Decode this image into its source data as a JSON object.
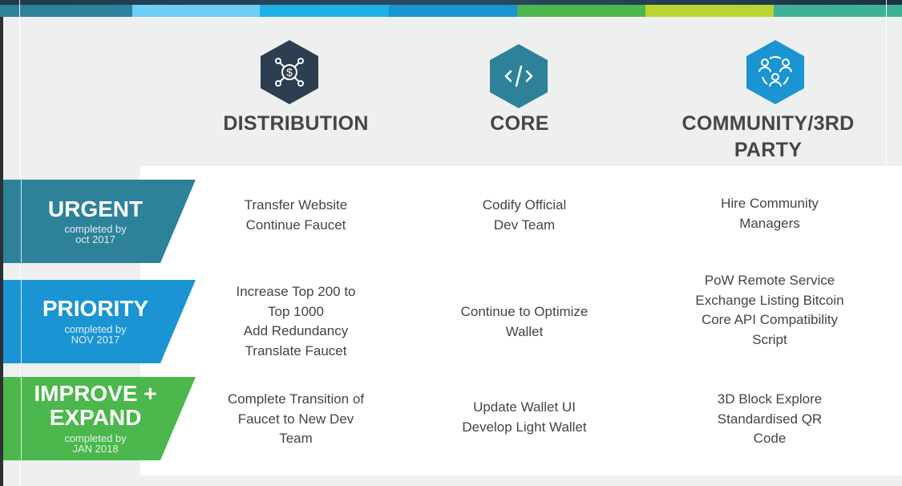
{
  "stripes": [
    {
      "color": "#2d8299"
    },
    {
      "color": "#6fcef5"
    },
    {
      "color": "#1fb0e6"
    },
    {
      "color": "#1b94d3"
    },
    {
      "color": "#4bb74c"
    },
    {
      "color": "#bbd530"
    },
    {
      "color": "#40b197"
    }
  ],
  "columns": [
    {
      "icon": "money-network-icon",
      "title": "DISTRIBUTION",
      "color": "#2c3e50"
    },
    {
      "icon": "code-icon",
      "title": "CORE",
      "color": "#2d8299"
    },
    {
      "icon": "community-icon",
      "title": "COMMUNITY/3RD PARTY",
      "title_line1": "COMMUNITY/3RD",
      "title_line2": "PARTY",
      "color": "#1b94d3"
    }
  ],
  "rows": [
    {
      "title": "URGENT",
      "subtitle_line1": "completed by",
      "subtitle_line2": "oct 2017",
      "color": "#2d8299",
      "cells": [
        [
          "Transfer Website",
          "Continue Faucet"
        ],
        [
          "Codify Official",
          "Dev Team"
        ],
        [
          "Hire Community",
          "Managers"
        ]
      ]
    },
    {
      "title": "PRIORITY",
      "subtitle_line1": "completed by",
      "subtitle_line2": "NOV 2017",
      "color": "#1b94d3",
      "cells": [
        [
          "Increase Top 200 to",
          "Top 1000",
          "Add Redundancy",
          "Translate Faucet"
        ],
        [
          "Continue to Optimize",
          "Wallet"
        ],
        [
          "PoW Remote Service",
          "Exchange Listing Bitcoin",
          "Core API Compatibility",
          "Script"
        ]
      ]
    },
    {
      "title_line1": "IMPROVE +",
      "title_line2": "EXPAND",
      "subtitle_line1": "completed by",
      "subtitle_line2": "JAN 2018",
      "color": "#4bb74c",
      "cells": [
        [
          "Complete Transition of",
          "Faucet to New Dev",
          "Team"
        ],
        [
          "Update Wallet UI",
          "Develop Light Wallet"
        ],
        [
          "3D Block Explore",
          "Standardised QR",
          "Code"
        ]
      ]
    }
  ]
}
